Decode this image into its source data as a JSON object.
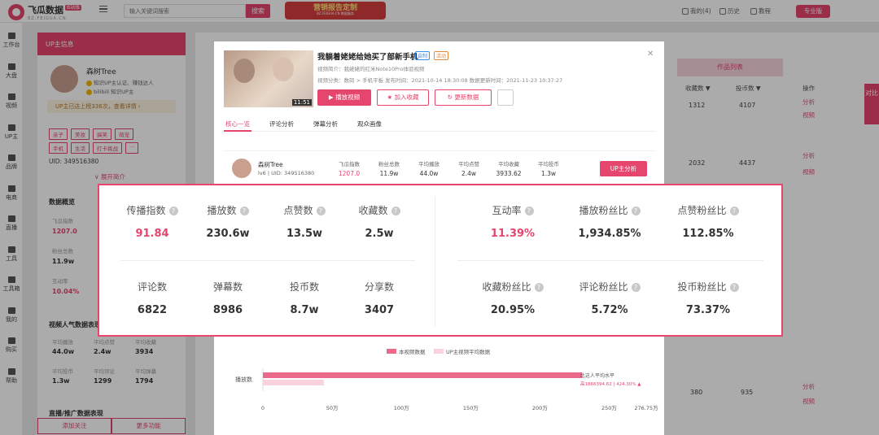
{
  "header": {
    "logo_name": "飞瓜数据",
    "logo_sub": "BZ.FEIGUA.CN",
    "logo_badge": "B站版",
    "search_placeholder": "输入关键词搜索",
    "search_button": "搜索",
    "banner_title": "营销报告定制",
    "banner_sub": "BZ.FEIGUA.CN 数据服务",
    "messages": "我的(4)",
    "history": "历史",
    "tutorial": "教程",
    "pro_button": "专业版"
  },
  "leftnav": [
    {
      "label": "工作台",
      "icon": "desk-icon"
    },
    {
      "label": "大盘",
      "icon": "market-icon"
    },
    {
      "label": "视频",
      "icon": "video-icon"
    },
    {
      "label": "UP主",
      "icon": "up-icon"
    },
    {
      "label": "品牌",
      "icon": "brand-icon"
    },
    {
      "label": "电商",
      "icon": "shop-icon"
    },
    {
      "label": "直播",
      "icon": "live-icon"
    },
    {
      "label": "工具",
      "icon": "tool-icon"
    },
    {
      "label": "工具箱",
      "icon": "toolbox-icon"
    },
    {
      "label": "我的",
      "icon": "user-icon"
    },
    {
      "label": "购买",
      "icon": "buy-icon"
    },
    {
      "label": "帮助",
      "icon": "help-icon"
    }
  ],
  "leftpanel": {
    "header_tag": "UP主信息",
    "name": "森树Tree",
    "line1": "知识UP主认证、赚钱达人",
    "line2": "bilibili 知识UP主",
    "rank_text": "UP主已达上榜336次，查看详情 ›",
    "tags_row1": [
      "亲子",
      "美妆",
      "搞笑",
      "萌宠"
    ],
    "tags_row2": [
      "手机",
      "生活",
      "打卡挑战",
      "···"
    ],
    "uid": "UID: 349516380",
    "expand": "∨ 展开简介",
    "section_overview": "数据概览",
    "overview": [
      {
        "k": "飞瓜指数",
        "v": "1207.0",
        "pink": true
      },
      {
        "k": "粉丝总数",
        "v": "11.9w",
        "pink": false
      },
      {
        "k": "互动率",
        "v": "10.04%",
        "pink": true
      }
    ],
    "section_popular": "视频人气数据表现",
    "popular_labels": [
      "平均播放",
      "平均点赞",
      "平均收藏",
      "平均投币",
      "平均评论",
      "平均弹幕"
    ],
    "popular_values": [
      "44.0w",
      "2.4w",
      "3934",
      "1.3w",
      "1299",
      "1794"
    ],
    "section_live": "直播/推广数据表现",
    "footer_follow": "添加关注",
    "footer_more": "更多功能"
  },
  "background": {
    "works_button": "作品列表",
    "headers": [
      "收藏数 ▼",
      "投币数 ▼",
      "操作"
    ],
    "rows": [
      [
        "1312",
        "4107"
      ],
      [
        "2032",
        "4437"
      ],
      [
        "380",
        "935"
      ]
    ],
    "action": "分析",
    "action2": "视频",
    "side_float": "对比"
  },
  "modal": {
    "title": "我躺着姥姥给她买了部新手机",
    "badge_orig": "自制",
    "badge_event": "活动",
    "duration": "11:51",
    "meta1": "视频简介：我姥姥的红米Note10Pro体验视频",
    "meta2": "视频分类：数码 > 手机平板    发布时间：2021-10-14 18:30:08  数据更新时间：2021-11-23 10:37:27",
    "btn_play": "播放视频",
    "btn_fav": "加入收藏",
    "btn_refresh": "更新数据",
    "tabs": [
      "核心一览",
      "评论分析",
      "弹幕分析",
      "观众画像"
    ],
    "up": {
      "name": "森树Tree",
      "uid": "lv6 | UID: 349516380",
      "cols": [
        {
          "k": "飞瓜指数",
          "v": "1207.0",
          "pink": true
        },
        {
          "k": "粉丝总数",
          "v": "11.9w"
        },
        {
          "k": "平均播放",
          "v": "44.0w"
        },
        {
          "k": "平均点赞",
          "v": "2.4w"
        },
        {
          "k": "平均收藏",
          "v": "3933.62"
        },
        {
          "k": "平均投币",
          "v": "1.3w"
        }
      ],
      "analysis_button": "UP主分析"
    },
    "legend_this": "本视频数据",
    "legend_avg": "UP主视频平均数据",
    "chart_category": "播放数",
    "chart_note1": "比这人平均水平",
    "chart_note2": "高1866394.62 | 424.30% ▲",
    "colors": {
      "this": "#eb6a8c",
      "avg": "#f8d2dc"
    }
  },
  "chart_data": {
    "type": "bar",
    "categories": [
      "播放数"
    ],
    "series": [
      {
        "name": "本视频数据",
        "values": [
          2306000
        ]
      },
      {
        "name": "UP主视频平均数据",
        "values": [
          440000
        ]
      }
    ],
    "x_ticks": [
      "0",
      "50万",
      "100万",
      "150万",
      "200万",
      "250万",
      "276.75万"
    ],
    "xlim": [
      0,
      2767500
    ]
  },
  "metrics": {
    "left": [
      {
        "label": "传播指数",
        "value": "91.84",
        "pink": true,
        "help": true
      },
      {
        "label": "播放数",
        "value": "230.6w"
      },
      {
        "label": "点赞数",
        "value": "13.5w"
      },
      {
        "label": "收藏数",
        "value": "2.5w"
      },
      {
        "label": "评论数",
        "value": "6822"
      },
      {
        "label": "弹幕数",
        "value": "8986"
      },
      {
        "label": "投币数",
        "value": "8.7w"
      },
      {
        "label": "分享数",
        "value": "3407"
      }
    ],
    "right": [
      {
        "label": "互动率",
        "value": "11.39%",
        "pink": true
      },
      {
        "label": "播放粉丝比",
        "value": "1,934.85%"
      },
      {
        "label": "点赞粉丝比",
        "value": "112.85%"
      },
      {
        "label": "收藏粉丝比",
        "value": "20.95%"
      },
      {
        "label": "评论粉丝比",
        "value": "5.72%"
      },
      {
        "label": "投币粉丝比",
        "value": "73.37%"
      }
    ],
    "help_glyph": "?"
  }
}
